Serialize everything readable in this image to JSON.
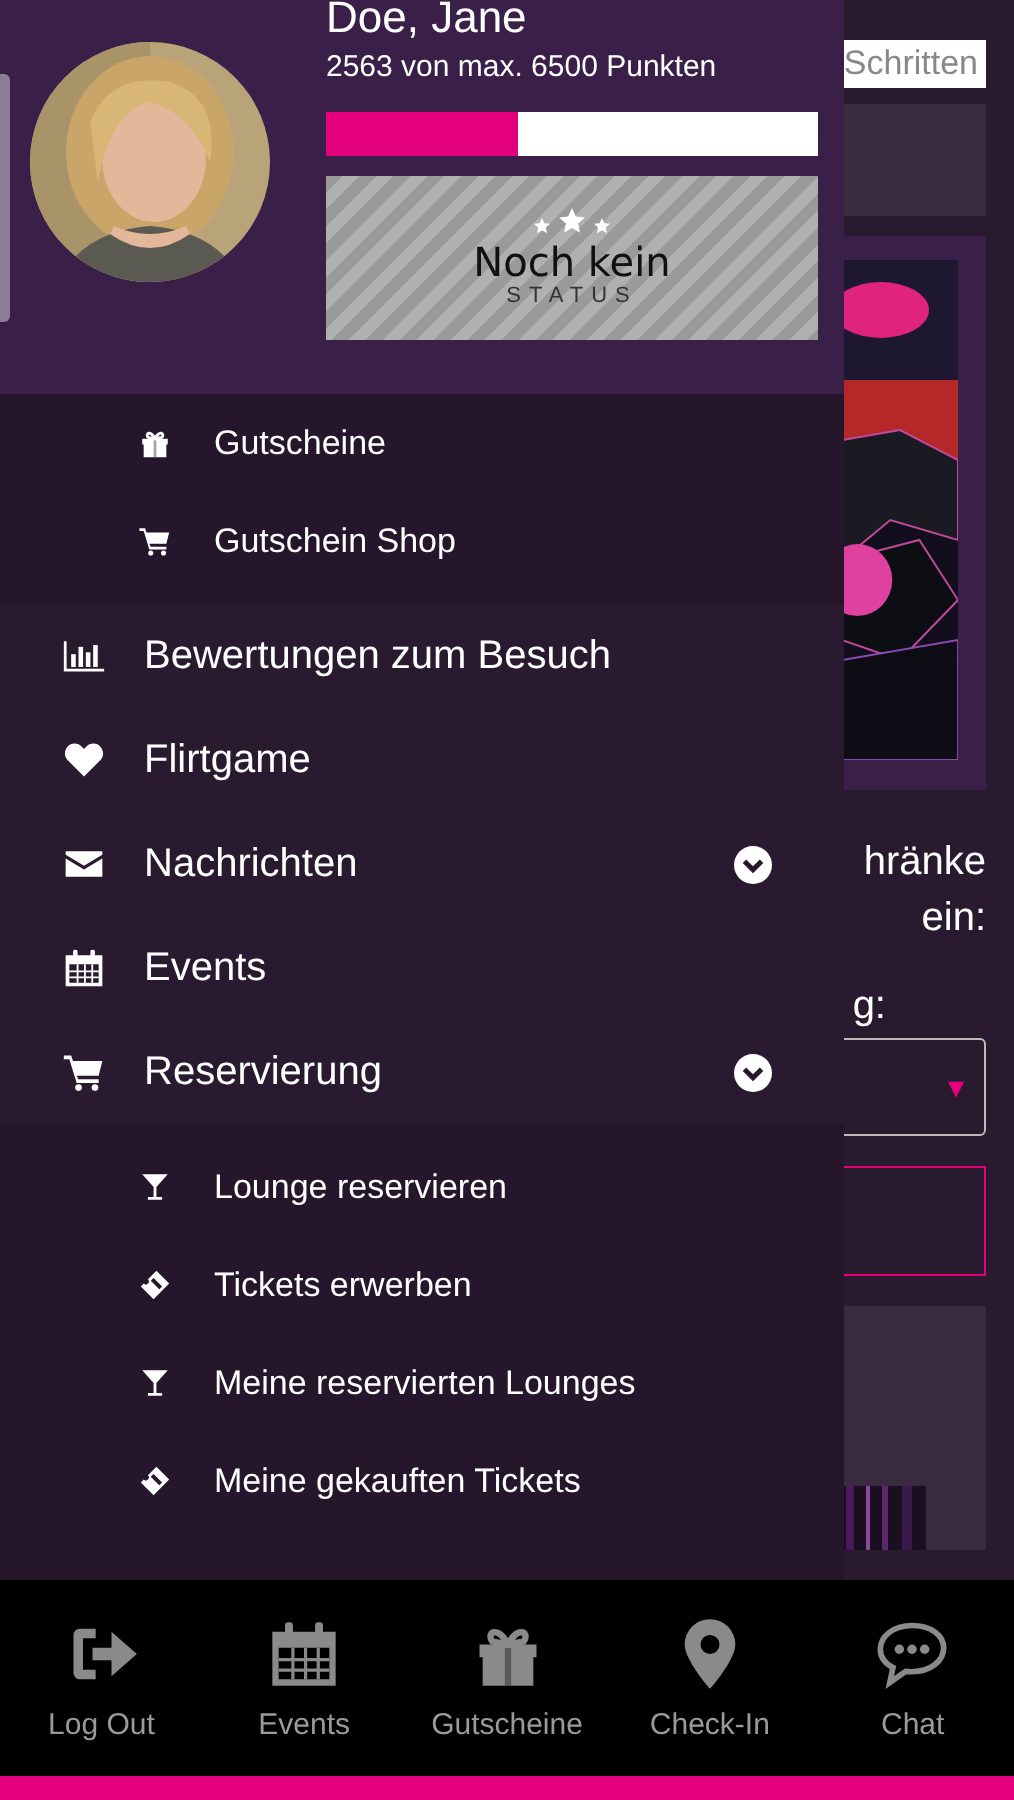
{
  "profile": {
    "name": "Doe, Jane",
    "points": "2563  von max. 6500 Punkten",
    "level": 0.39,
    "status": {
      "title": "Noch kein",
      "subtitle": "STATUS"
    }
  },
  "menu": [
    {
      "kind": "sub",
      "label": "Gutscheine",
      "expandable": false
    },
    {
      "kind": "sub",
      "label": "Gutschein Shop",
      "expandable": false
    },
    {
      "kind": "main",
      "label": "Bewertungen zum Besuch",
      "expandable": false
    },
    {
      "kind": "main",
      "label": "Flirtgame",
      "expandable": false
    },
    {
      "kind": "main",
      "label": "Nachrichten",
      "expandable": true
    },
    {
      "kind": "main",
      "label": "Events",
      "expandable": false
    },
    {
      "kind": "main",
      "label": "Reservierung",
      "expandable": true
    },
    {
      "kind": "sub",
      "label": "Lounge reservieren",
      "expandable": false
    },
    {
      "kind": "sub",
      "label": "Tickets erwerben",
      "expandable": false
    },
    {
      "kind": "sub",
      "label": "Meine reservierten Lounges",
      "expandable": false
    },
    {
      "kind": "sub",
      "label": "Meine gekauften Tickets",
      "expandable": false
    }
  ],
  "background_page": {
    "search_value": "Schritten",
    "text_1": "hränke",
    "text_2": "ein:",
    "text_3": "g:",
    "dropdown_caret": "▾"
  },
  "bottom_nav": [
    {
      "label": "Log Out"
    },
    {
      "label": "Events"
    },
    {
      "label": "Gutscheine"
    },
    {
      "label": "Check-In"
    },
    {
      "label": "Chat"
    }
  ]
}
